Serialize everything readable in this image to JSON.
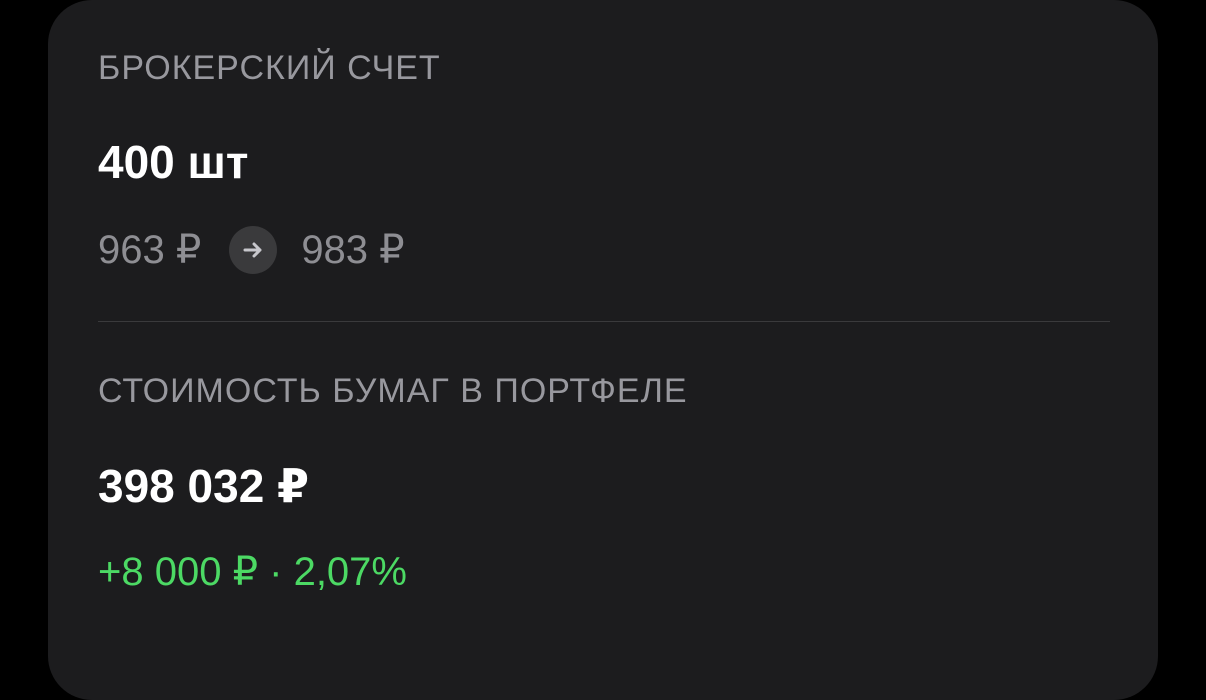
{
  "broker_account": {
    "label": "БРОКЕРСКИЙ СЧЕТ",
    "quantity": "400 шт",
    "price_from": "963 ₽",
    "price_to": "983 ₽"
  },
  "portfolio_value": {
    "label": "СТОИМОСТЬ БУМАГ В ПОРТФЕЛЕ",
    "value": "398 032 ₽",
    "change": "+8 000 ₽ · 2,07%"
  },
  "colors": {
    "background": "#000000",
    "card": "#1c1c1e",
    "label_gray": "#98989e",
    "positive_green": "#4cd964"
  },
  "icons": {
    "price_change": "arrow-right-icon"
  }
}
